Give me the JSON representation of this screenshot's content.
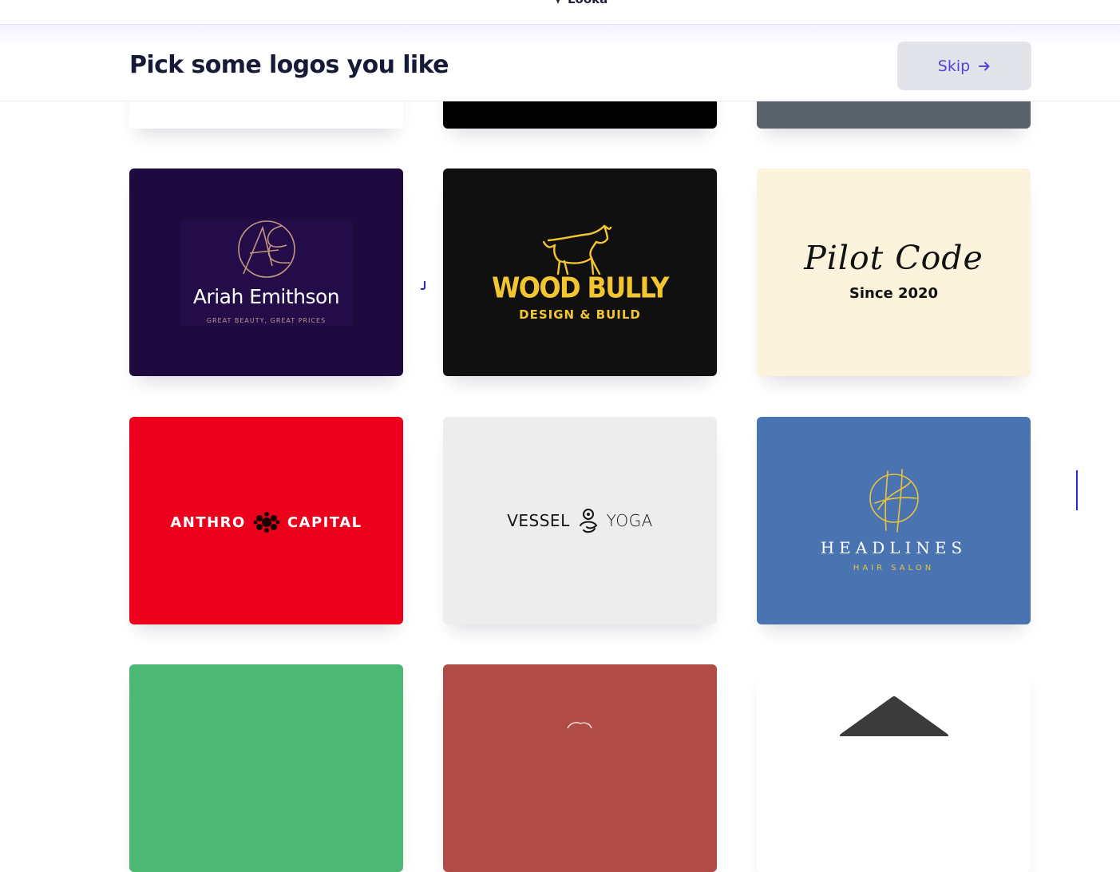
{
  "brand": {
    "name": "Looka"
  },
  "header": {
    "title": "Pick some logos you like",
    "skip_label": "Skip"
  },
  "colors": {
    "accent": "#5143d9",
    "title": "#171a36",
    "skip_bg": "#e3e4ea"
  },
  "logos": [
    {
      "id": "partial-white",
      "background": "#ffffff"
    },
    {
      "id": "partial-black",
      "background": "#000000"
    },
    {
      "id": "partial-slate",
      "background": "#5a636c"
    },
    {
      "id": "ariah",
      "background": "#1f0a40",
      "name": "Ariah Emithson",
      "tagline": "GREAT BEAUTY, GREAT PRICES",
      "monogram": "AE"
    },
    {
      "id": "woodbully",
      "background": "#101010",
      "name": "WOOD BULLY",
      "tagline": "DESIGN & BUILD"
    },
    {
      "id": "pilotcode",
      "background": "#fcf3dc",
      "name": "Pilot Code",
      "tagline": "Since 2020"
    },
    {
      "id": "anthro",
      "background": "#ec001c",
      "name_left": "ANTHRO",
      "name_right": "CAPITAL"
    },
    {
      "id": "vessel",
      "background": "#ededed",
      "name_left": "VESSEL",
      "name_right": "YOGA"
    },
    {
      "id": "headlines",
      "background": "#4a74b1",
      "name": "HEADLINES",
      "tagline": "HAIR SALON"
    },
    {
      "id": "partial-green",
      "background": "#4db874"
    },
    {
      "id": "partial-brick",
      "background": "#b04c45"
    },
    {
      "id": "partial-white-2",
      "background": "#ffffff"
    }
  ]
}
